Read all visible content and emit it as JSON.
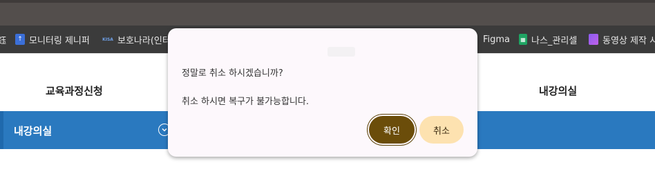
{
  "bookmarks": [
    {
      "label": "鈺",
      "icon": "bookmark-favicon"
    },
    {
      "label": "모니터링 제니퍼",
      "icon": "jennifer-favicon"
    },
    {
      "label": "보호나라(인터",
      "icon": "kisa-favicon",
      "badge": "KISA"
    },
    {
      "label": "Figma",
      "icon": "figma"
    },
    {
      "label": "나스_관리셀",
      "icon": "sheets-icon"
    },
    {
      "label": "동영상 제작 시",
      "icon": "video-icon"
    }
  ],
  "tabs": {
    "left": "교육과정신청",
    "right": "내강의실"
  },
  "section": {
    "title": "내강의실",
    "toggle_icon": "chevron-down-icon"
  },
  "dialog": {
    "message": "정말로 취소 하시겠습니까?",
    "detail": "취소 하시면 복구가 불가능합니다.",
    "confirm_label": "확인",
    "cancel_label": "취소"
  },
  "colors": {
    "section_bar": "#2a79bf",
    "confirm_button": "#6b4d0a",
    "cancel_button": "#fde2b0"
  }
}
